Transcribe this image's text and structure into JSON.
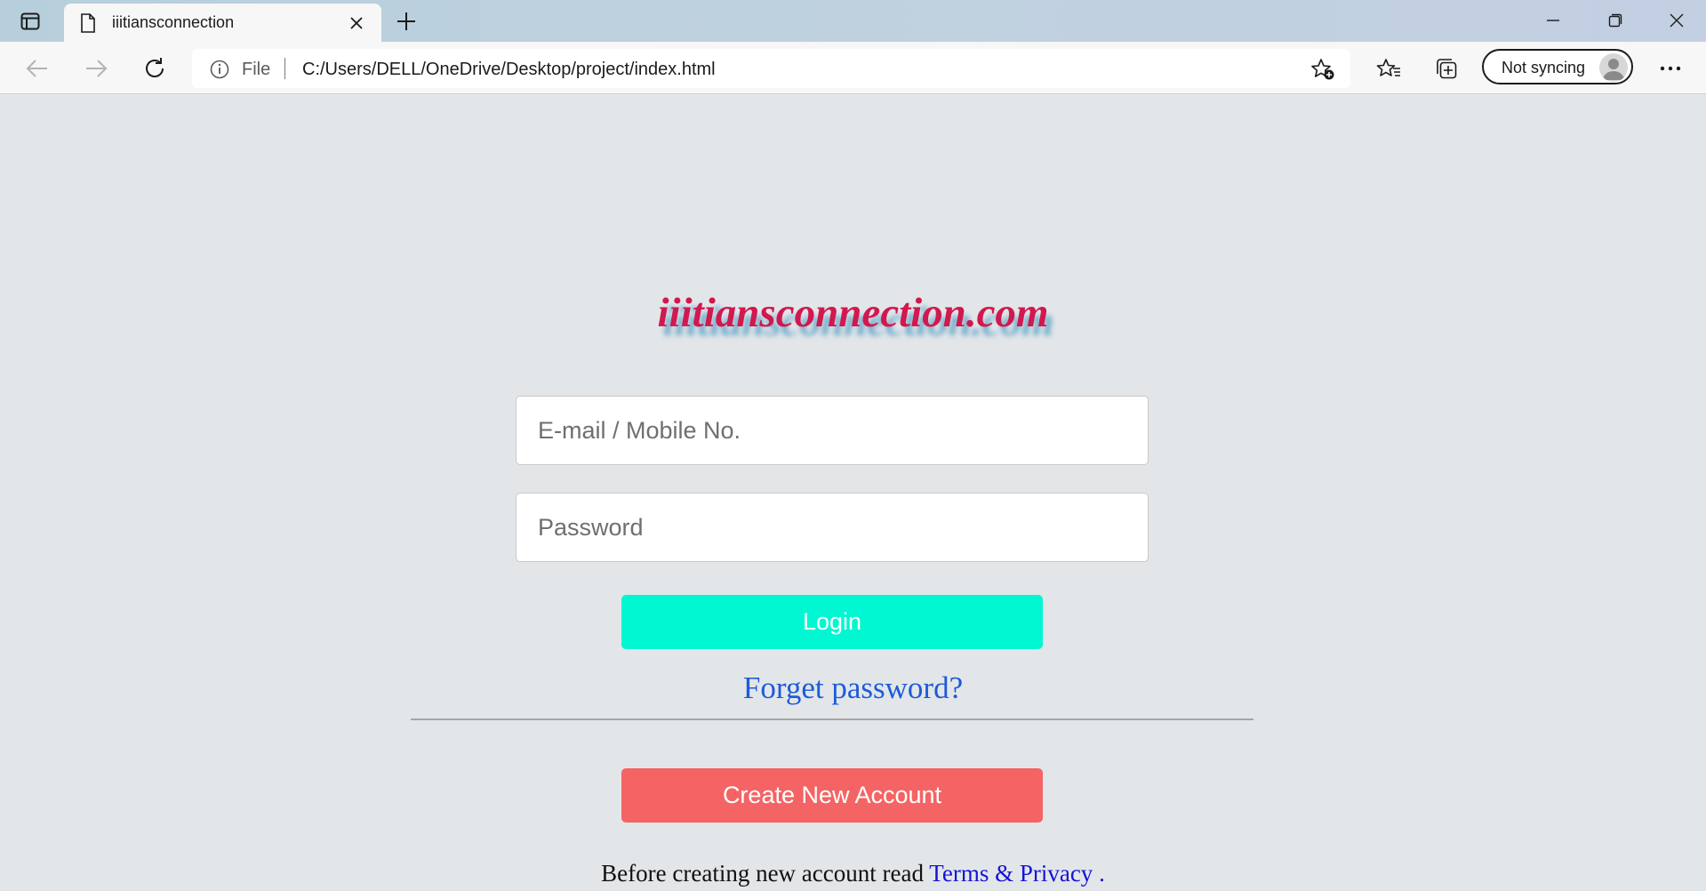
{
  "browser": {
    "tab_title": "iiitiansconnection",
    "address": {
      "scheme_label": "File",
      "url": "C:/Users/DELL/OneDrive/Desktop/project/index.html"
    },
    "profile_label": "Not syncing",
    "icons": {
      "tab_actions": "tab-actions-icon",
      "favicon": "page-icon",
      "close": "close-icon",
      "new_tab": "plus-icon",
      "back": "back-arrow-icon",
      "forward": "forward-arrow-icon",
      "refresh": "refresh-icon",
      "info": "info-icon",
      "add_favorite": "star-plus-icon",
      "favorites": "favorites-icon",
      "collections": "collections-icon",
      "more": "more-icon"
    }
  },
  "page": {
    "brand": "iiitiansconnection.com",
    "email_placeholder": "E-mail / Mobile No.",
    "password_placeholder": "Password",
    "login_label": "Login",
    "forgot_label": "Forget password?",
    "create_label": "Create New Account",
    "terms_prefix": "Before creating new account read ",
    "terms_link": "Terms & Privacy",
    "terms_suffix": " ."
  },
  "colors": {
    "brand": "#d1184f",
    "login": "#00f7d2",
    "create": "#f46464",
    "link": "#1e5bd8",
    "background": "#e3e6e9"
  }
}
